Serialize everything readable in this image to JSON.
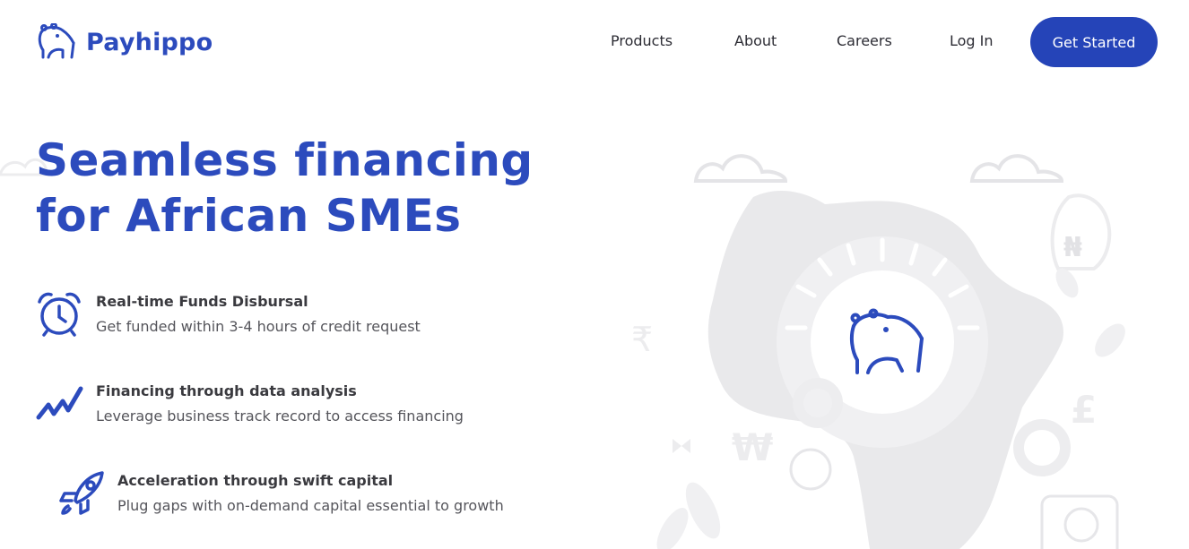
{
  "brand": {
    "name": "Payhippo",
    "logo_icon": "hippo-icon",
    "primary_color": "#2c4bbd",
    "button_color": "#2544b8"
  },
  "nav": {
    "products": "Products",
    "about": "About",
    "careers": "Careers",
    "login": "Log In",
    "get_started": "Get Started"
  },
  "hero": {
    "title_line1": "Seamless financing",
    "title_line2": "for African SMEs"
  },
  "features": [
    {
      "icon": "alarm-clock-icon",
      "title": "Real-time Funds Disbursal",
      "subtitle": "Get funded within 3-4 hours of credit request"
    },
    {
      "icon": "trend-chart-icon",
      "title": "Financing through data analysis",
      "subtitle": "Leverage business track record to access financing"
    },
    {
      "icon": "rocket-icon",
      "title": "Acceleration through swift capital",
      "subtitle": "Plug gaps with on-demand capital essential to growth"
    }
  ],
  "illustration": {
    "description_icons": [
      "africa-map-icon",
      "hippo-icon",
      "naira-icon",
      "rupee-icon",
      "won-icon",
      "pound-icon",
      "gear-icon",
      "cloud-icon",
      "rocket-icon",
      "plant-icon"
    ]
  }
}
